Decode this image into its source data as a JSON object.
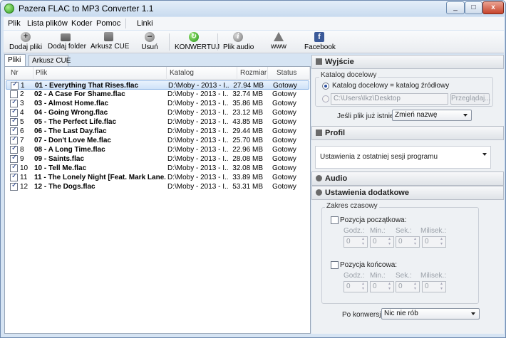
{
  "window": {
    "title": "Pazera FLAC to MP3 Converter 1.1",
    "controls": [
      "_",
      "□",
      "x"
    ]
  },
  "menu": [
    "Plik",
    "Lista plików",
    "Koder",
    "Pomoc",
    "Linki"
  ],
  "toolbar": [
    {
      "label": "Dodaj pliki",
      "icon": "add-file-icon"
    },
    {
      "label": "Dodaj folder",
      "icon": "folder-icon"
    },
    {
      "label": "Arkusz CUE",
      "icon": "cue-icon"
    },
    {
      "label": "Usuń",
      "icon": "remove-icon"
    },
    {
      "label": "KONWERTUJ",
      "icon": "convert-icon"
    },
    {
      "label": "Plik audio",
      "icon": "info-icon"
    },
    {
      "label": "www",
      "icon": "home-icon"
    },
    {
      "label": "Facebook",
      "icon": "facebook-icon"
    }
  ],
  "tabs": [
    "Pliki",
    "Arkusz CUE"
  ],
  "columns": [
    "Nr",
    "Plik",
    "Katalog",
    "Rozmiar",
    "Status"
  ],
  "files": [
    {
      "nr": "1",
      "name": "01 - Everything That Rises.flac",
      "dir": "D:\\Moby - 2013 - I...",
      "size": "27.94 MB",
      "status": "Gotowy",
      "checked": true,
      "selected": true
    },
    {
      "nr": "2",
      "name": "02 - A Case For Shame.flac",
      "dir": "D:\\Moby - 2013 - I...",
      "size": "32.74 MB",
      "status": "Gotowy",
      "checked": false,
      "selected": false
    },
    {
      "nr": "3",
      "name": "03 - Almost Home.flac",
      "dir": "D:\\Moby - 2013 - I...",
      "size": "35.86 MB",
      "status": "Gotowy",
      "checked": true,
      "selected": false
    },
    {
      "nr": "4",
      "name": "04 - Going Wrong.flac",
      "dir": "D:\\Moby - 2013 - I...",
      "size": "23.12 MB",
      "status": "Gotowy",
      "checked": true,
      "selected": false
    },
    {
      "nr": "5",
      "name": "05 - The Perfect Life.flac",
      "dir": "D:\\Moby - 2013 - I...",
      "size": "43.85 MB",
      "status": "Gotowy",
      "checked": true,
      "selected": false
    },
    {
      "nr": "6",
      "name": "06 - The Last Day.flac",
      "dir": "D:\\Moby - 2013 - I...",
      "size": "29.44 MB",
      "status": "Gotowy",
      "checked": true,
      "selected": false
    },
    {
      "nr": "7",
      "name": "07 - Don't Love Me.flac",
      "dir": "D:\\Moby - 2013 - I...",
      "size": "25.70 MB",
      "status": "Gotowy",
      "checked": true,
      "selected": false
    },
    {
      "nr": "8",
      "name": "08 - A Long Time.flac",
      "dir": "D:\\Moby - 2013 - I...",
      "size": "22.96 MB",
      "status": "Gotowy",
      "checked": true,
      "selected": false
    },
    {
      "nr": "9",
      "name": "09 - Saints.flac",
      "dir": "D:\\Moby - 2013 - I...",
      "size": "28.08 MB",
      "status": "Gotowy",
      "checked": true,
      "selected": false
    },
    {
      "nr": "10",
      "name": "10 - Tell Me.flac",
      "dir": "D:\\Moby - 2013 - I...",
      "size": "32.08 MB",
      "status": "Gotowy",
      "checked": true,
      "selected": false
    },
    {
      "nr": "11",
      "name": "11 - The Lonely Night [Feat. Mark Lane...",
      "dir": "D:\\Moby - 2013 - I...",
      "size": "33.89 MB",
      "status": "Gotowy",
      "checked": true,
      "selected": false
    },
    {
      "nr": "12",
      "name": "12 - The Dogs.flac",
      "dir": "D:\\Moby - 2013 - I...",
      "size": "53.31 MB",
      "status": "Gotowy",
      "checked": true,
      "selected": false
    }
  ],
  "output": {
    "header": "Wyjście",
    "group_title": "Katalog docelowy",
    "radio_same": "Katalog docelowy = katalog źródłowy",
    "path": "C:\\Users\\Ikz\\Desktop",
    "browse": "Przeglądaj...",
    "exists_label": "Jeśli plik już istnieje:",
    "exists_value": "Zmień nazwę"
  },
  "profile": {
    "header": "Profil",
    "value": "Ustawienia z ostatniej sesji programu"
  },
  "audio": {
    "header": "Audio"
  },
  "extra": {
    "header": "Ustawienia dodatkowe",
    "range_title": "Zakres czasowy",
    "start_label": "Pozycja początkowa:",
    "end_label": "Pozycja końcowa:",
    "time_units": [
      "Godz.:",
      "Min.:",
      "Sek.:",
      "Milisek.:"
    ],
    "time_value": "0",
    "after_label": "Po konwersji:",
    "after_value": "Nic nie rób"
  },
  "colors": {
    "accent": "#2f9a1f",
    "selection": "#cfe2f8",
    "facebook": "#3b5a99"
  }
}
